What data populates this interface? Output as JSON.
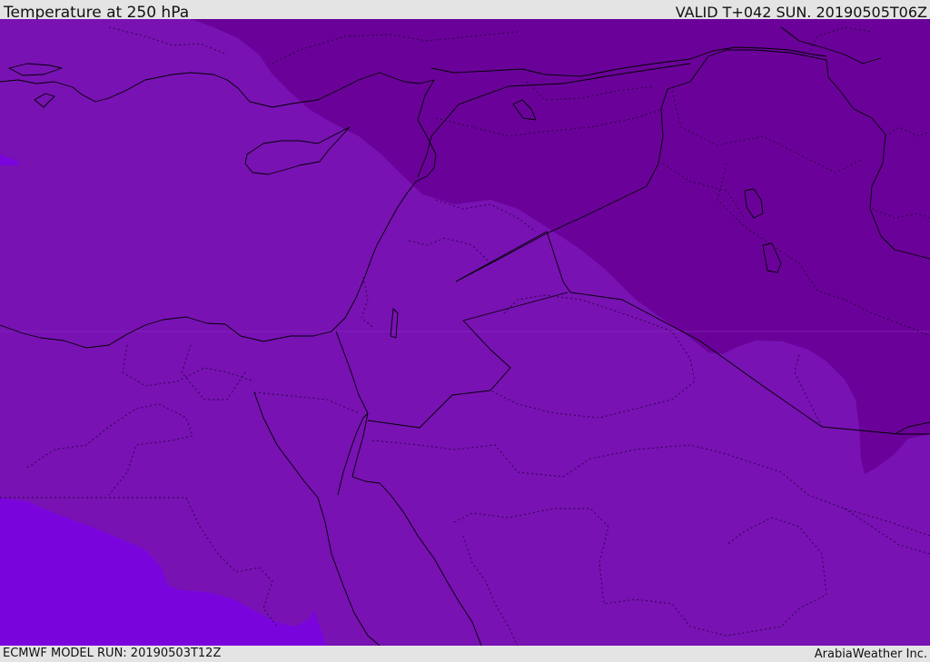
{
  "header": {
    "title": "Temperature at 250 hPa",
    "valid_time": "VALID T+042 SUN. 20190505T06Z"
  },
  "footer": {
    "model_run": "ECMWF MODEL RUN: 20190503T12Z",
    "credit": "ArabiaWeather Inc."
  },
  "map": {
    "field": "temperature",
    "level": "250 hPa",
    "colors": {
      "cold_zone": "#6a0299",
      "mid_zone": "#7812b3",
      "warm_zone": "#7a05dc",
      "border": "#000000"
    }
  }
}
